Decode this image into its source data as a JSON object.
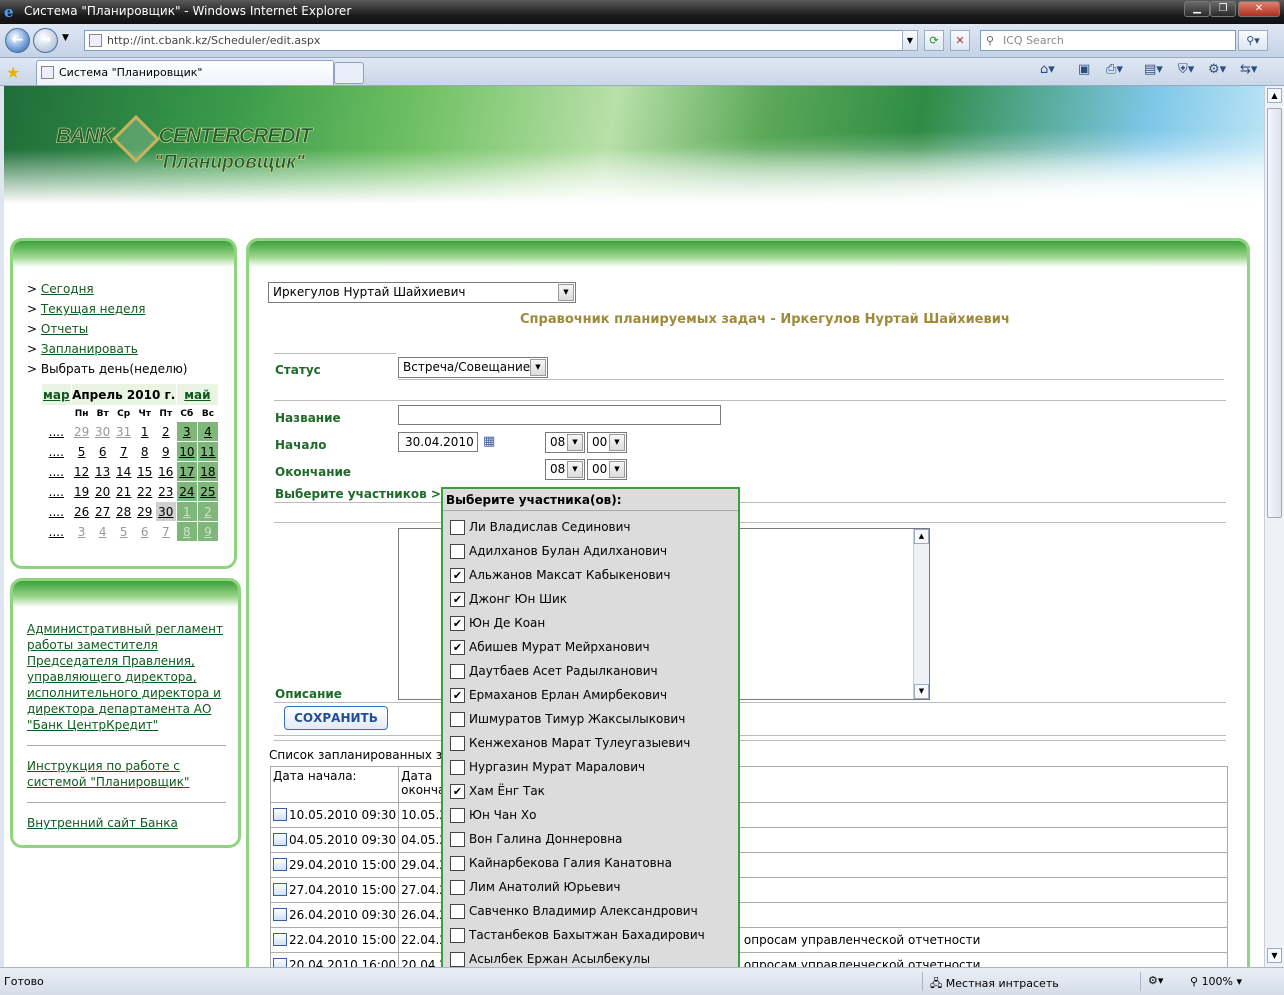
{
  "window": {
    "title": "Система \"Планировщик\" - Windows Internet Explorer"
  },
  "browser": {
    "url": "http://int.cbank.kz/Scheduler/edit.aspx",
    "search_placeholder": "ICQ Search",
    "tab_title": "Система \"Планировщик\"",
    "status": "Готово",
    "zone": "Местная интрасеть",
    "zoom": "100%"
  },
  "header": {
    "logo_bank": "BANK",
    "logo_center": "CENTERCREDIT",
    "logo_sub": "\"Планировщик\""
  },
  "nav": {
    "items": [
      {
        "label": "Сегодня"
      },
      {
        "label": "Текущая неделя"
      },
      {
        "label": "Отчеты"
      },
      {
        "label": "Запланировать"
      },
      {
        "label": "Выбрать день(неделю)"
      }
    ]
  },
  "calendar": {
    "prev": "мар",
    "title": "Апрель 2010 г.",
    "next": "май",
    "dow": [
      "Пн",
      "Вт",
      "Ср",
      "Чт",
      "Пт",
      "Сб",
      "Вс"
    ],
    "weeks": [
      [
        "29",
        "30",
        "31",
        "1",
        "2",
        "3",
        "4"
      ],
      [
        "5",
        "6",
        "7",
        "8",
        "9",
        "10",
        "11"
      ],
      [
        "12",
        "13",
        "14",
        "15",
        "16",
        "17",
        "18"
      ],
      [
        "19",
        "20",
        "21",
        "22",
        "23",
        "24",
        "25"
      ],
      [
        "26",
        "27",
        "28",
        "29",
        "30",
        "1",
        "2"
      ],
      [
        "3",
        "4",
        "5",
        "6",
        "7",
        "8",
        "9"
      ]
    ],
    "week_link": "....",
    "selected": "30"
  },
  "links": {
    "regulation": "Административный регламент работы заместителя Председателя Правления, управляющего директора, исполнительного директора и директора департамента АО \"Банк ЦентрКредит\"",
    "instruction": "Инструкция по работе с системой \"Планировщик\"",
    "intranet": "Внутренний сайт Банка"
  },
  "form": {
    "user_select": "Иркегулов Нуртай Шайхиевич",
    "section_title": "Справочник планируемых задач - Иркегулов Нуртай Шайхиевич",
    "status_label": "Статус",
    "status_value": "Встреча/Совещание",
    "name_label": "Название",
    "name_value": "",
    "start_label": "Начало",
    "start_date": "30.04.2010",
    "start_hour": "08",
    "start_min": "00",
    "end_label": "Окончание",
    "end_hour": "08",
    "end_min": "00",
    "participants_label": "Выберите участников >>",
    "description_label": "Описание",
    "save_label": "СОХРАНИТЬ"
  },
  "picker": {
    "title": "Выберите участника(ов):",
    "items": [
      {
        "name": "Ли Владислав Сединович",
        "checked": false
      },
      {
        "name": "Адилханов Булан Адилханович",
        "checked": false
      },
      {
        "name": "Альжанов Максат Кабыкенович",
        "checked": true
      },
      {
        "name": "Джонг Юн Шик",
        "checked": true
      },
      {
        "name": "Юн Де Коан",
        "checked": true
      },
      {
        "name": "Абишев Мурат Мейрханович",
        "checked": true
      },
      {
        "name": "Даутбаев Асет Радылканович",
        "checked": false
      },
      {
        "name": "Ермаханов Ерлан Амирбекович",
        "checked": true
      },
      {
        "name": "Ишмуратов Тимур Жаксылыкович",
        "checked": false
      },
      {
        "name": "Кенжеханов Марат Тулеугазыевич",
        "checked": false
      },
      {
        "name": "Нургазин Мурат Маралович",
        "checked": false
      },
      {
        "name": "Хам Ёнг Так",
        "checked": true
      },
      {
        "name": "Юн Чан Хо",
        "checked": false
      },
      {
        "name": "Вон Галина Доннеровна",
        "checked": false
      },
      {
        "name": "Кайнарбекова Галия Канатовна",
        "checked": false
      },
      {
        "name": "Лим Анатолий Юрьевич",
        "checked": false
      },
      {
        "name": "Савченко Владимир Александрович",
        "checked": false
      },
      {
        "name": "Тастанбеков Бахытжан Бахадирович",
        "checked": false
      },
      {
        "name": "Асылбек Ержан Асылбекулы",
        "checked": false
      }
    ]
  },
  "tasks": {
    "title": "Список запланированных зад",
    "col_start": "Дата начала:",
    "col_end_1": "Дата",
    "col_end_2": "оконча",
    "rows": [
      {
        "start": "10.05.2010 09:30",
        "end": "10.05.2",
        "desc": ""
      },
      {
        "start": "04.05.2010 09:30",
        "end": "04.05.2",
        "desc": ""
      },
      {
        "start": "29.04.2010 15:00",
        "end": "29.04.2",
        "desc": ""
      },
      {
        "start": "27.04.2010 15:00",
        "end": "27.04.2",
        "desc": ""
      },
      {
        "start": "26.04.2010 09:30",
        "end": "26.04.2",
        "desc": ""
      },
      {
        "start": "22.04.2010 15:00",
        "end": "22.04.2",
        "desc": "опросам управленческой отчетности"
      },
      {
        "start": "20.04.2010 16:00",
        "end": "20.04.2",
        "desc": "опросам управленческой отчетности"
      }
    ]
  }
}
